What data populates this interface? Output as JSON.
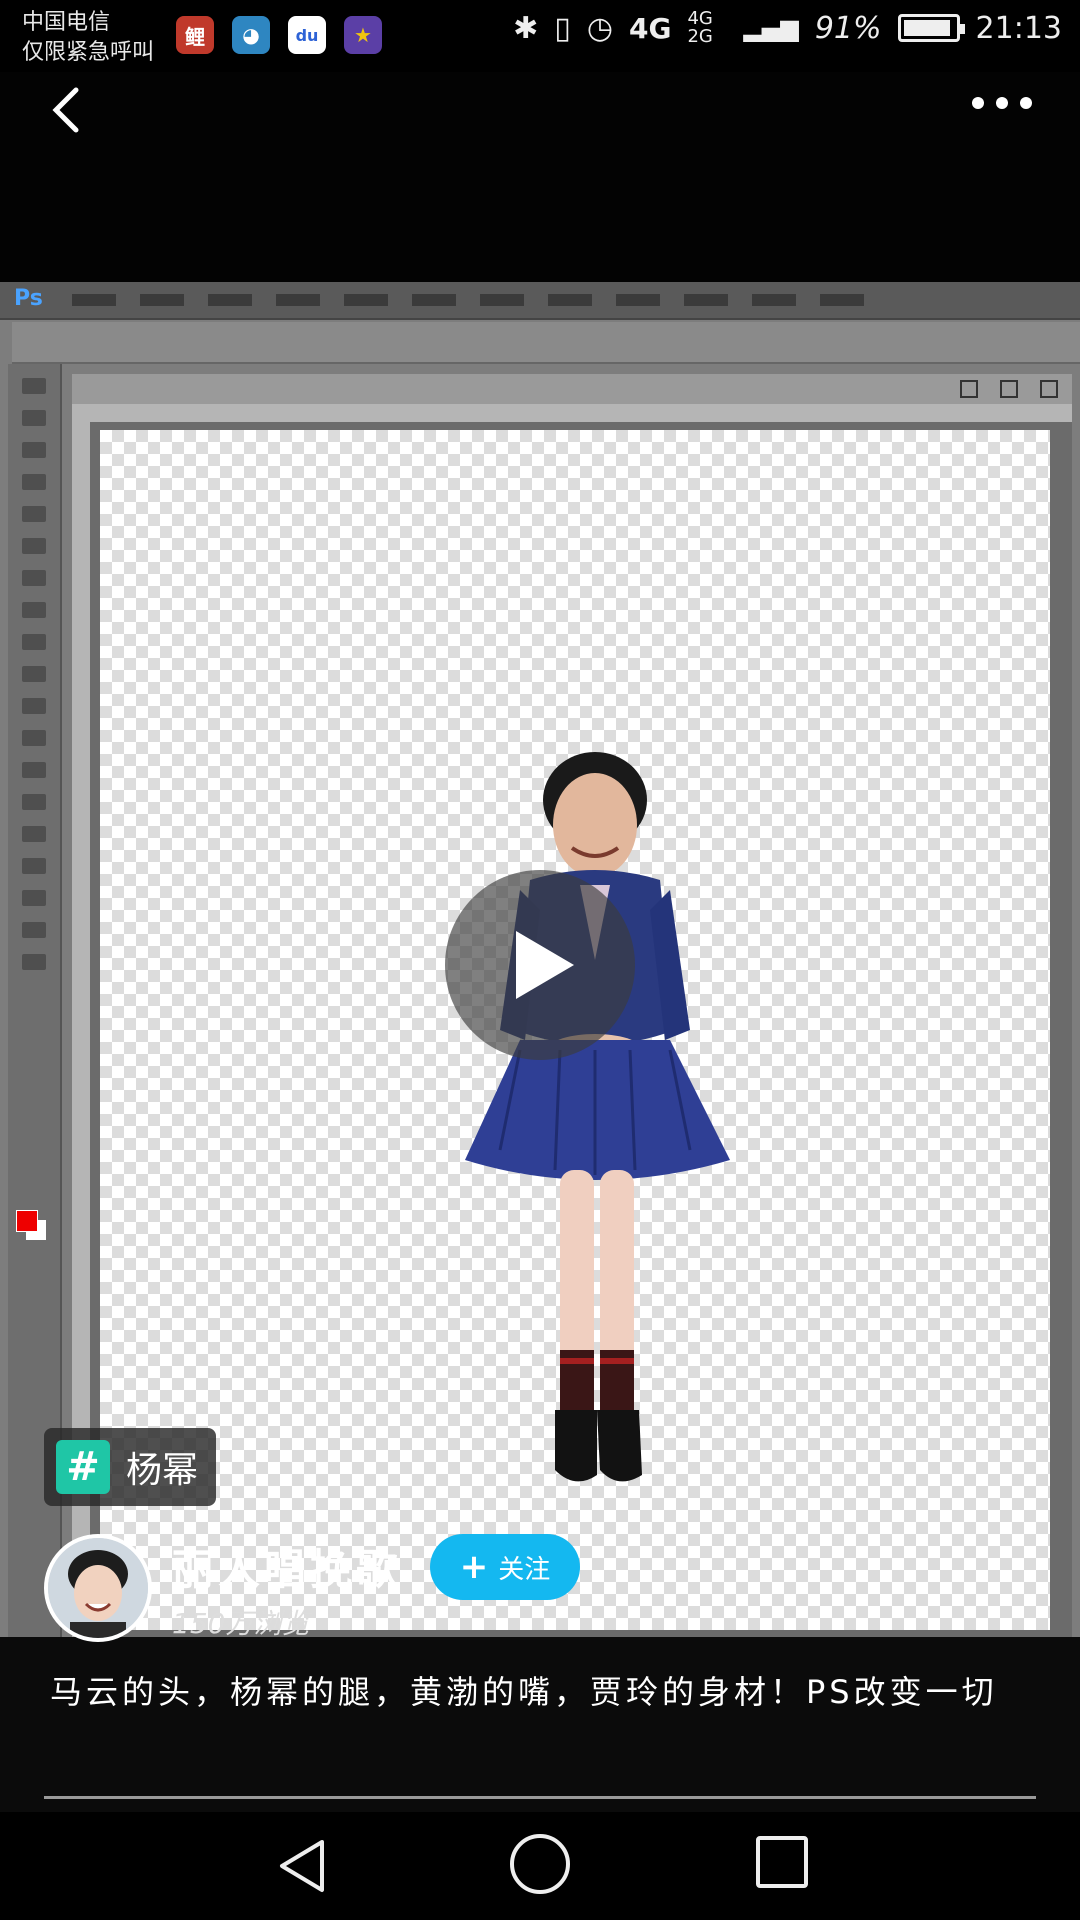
{
  "status_bar": {
    "carrier_line1": "中国电信",
    "carrier_line2": "仅限紧急呼叫",
    "notification_icons": [
      "app-icon-1",
      "qq-icon",
      "baidu-icon",
      "game-icon"
    ],
    "network_4g": "4G",
    "network_4g2g": "4G 2G",
    "battery_text": "91%",
    "battery_level": 0.91,
    "time": "21:13"
  },
  "video": {
    "ps_logo": "Ps"
  },
  "topic": {
    "hash": "#",
    "label": "杨幂"
  },
  "author": {
    "name": "丽人唱挽歌",
    "views": "150万浏览",
    "follow_plus": "+",
    "follow_label": "关注"
  },
  "description": "马云的头，杨幂的腿，黄渤的嘴，贾玲的身材！PS改变一切",
  "colors": {
    "follow_button": "#14b8f0",
    "topic_icon": "#1fc6a6"
  }
}
